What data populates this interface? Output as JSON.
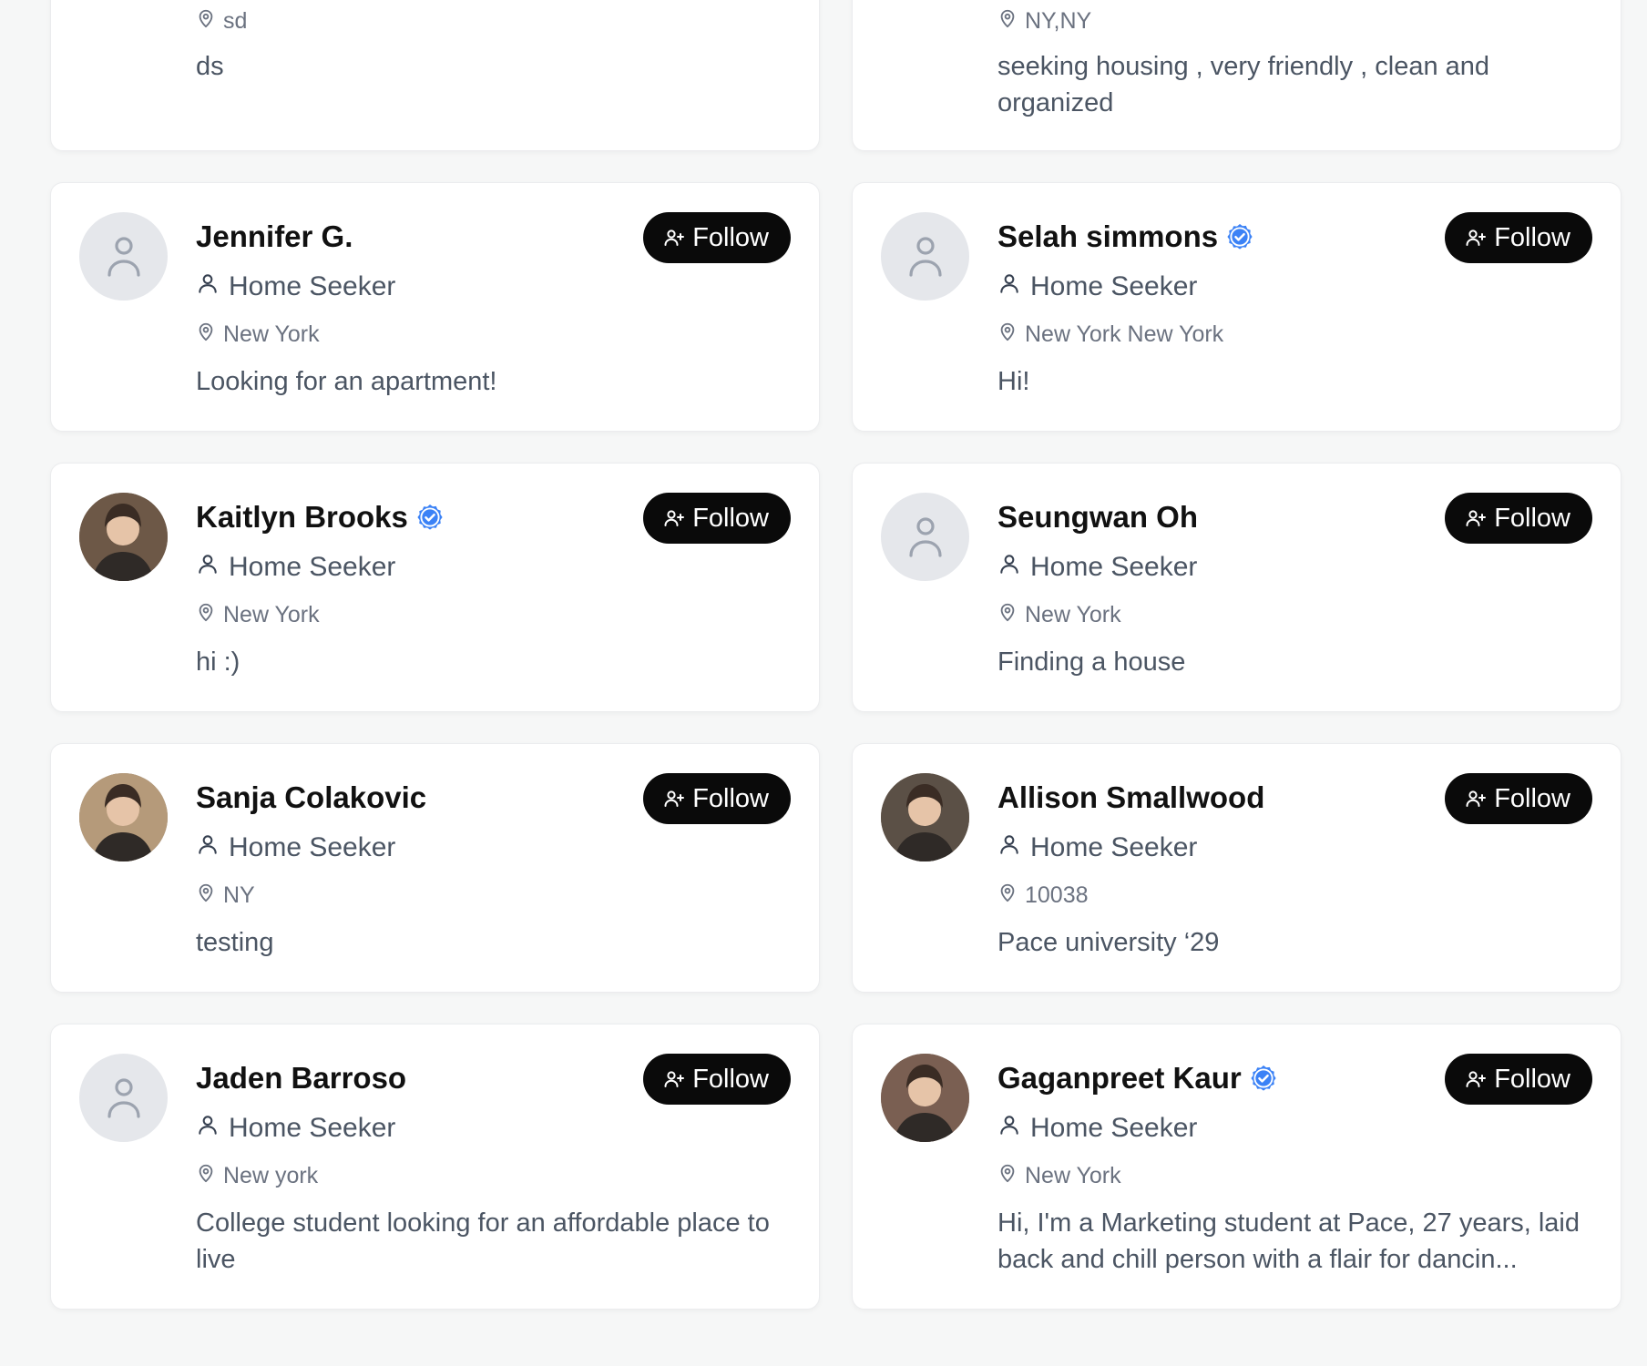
{
  "follow_label": "Follow",
  "top_cards": [
    {
      "location": "sd",
      "bio": "ds"
    },
    {
      "location": "NY,NY",
      "bio": "seeking housing , very friendly , clean and organized"
    }
  ],
  "profiles": [
    {
      "name": "Jennifer G.",
      "verified": false,
      "role": "Home Seeker",
      "location": "New York",
      "bio": "Looking for an apartment!",
      "avatar": "placeholder"
    },
    {
      "name": "Selah simmons",
      "verified": true,
      "role": "Home Seeker",
      "location": "New York New York",
      "bio": "Hi!",
      "avatar": "placeholder"
    },
    {
      "name": "Kaitlyn Brooks",
      "verified": true,
      "role": "Home Seeker",
      "location": "New York",
      "bio": "hi :)",
      "avatar": "photo"
    },
    {
      "name": "Seungwan Oh",
      "verified": false,
      "role": "Home Seeker",
      "location": "New York",
      "bio": "Finding a house",
      "avatar": "placeholder"
    },
    {
      "name": "Sanja Colakovic",
      "verified": false,
      "role": "Home Seeker",
      "location": "NY",
      "bio": "testing",
      "avatar": "photo"
    },
    {
      "name": "Allison Smallwood",
      "verified": false,
      "role": "Home Seeker",
      "location": "10038",
      "bio": "Pace university ‘29",
      "avatar": "photo"
    },
    {
      "name": "Jaden Barroso",
      "verified": false,
      "role": "Home Seeker",
      "location": "New york",
      "bio": "College student looking for an affordable place to live",
      "avatar": "placeholder"
    },
    {
      "name": "Gaganpreet Kaur",
      "verified": true,
      "role": "Home Seeker",
      "location": "New York",
      "bio": "Hi, I'm a Marketing student at Pace, 27 years, laid back and chill person with a flair for dancin...",
      "avatar": "photo"
    }
  ],
  "colors": {
    "page_bg": "#f6f7f7",
    "card_bg": "#ffffff",
    "button_bg": "#0a0a0a",
    "verified_blue": "#3b82f6",
    "muted_text": "#4b5563"
  }
}
